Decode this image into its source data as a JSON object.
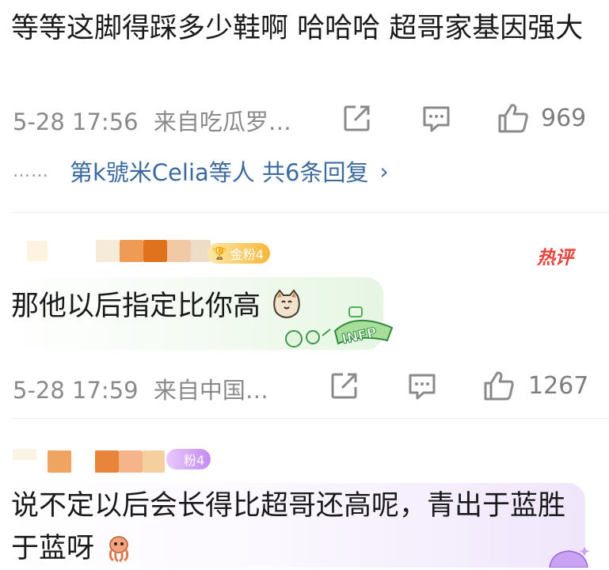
{
  "comment1": {
    "text": "等等这脚得踩多少鞋啊 哈哈哈 超哥家基因强大",
    "timestamp": "5-28 17:56",
    "source": "来自吃瓜罗…",
    "like_count": "969",
    "reply_dots": "……",
    "reply_summary": "第k號米Celia等人 共6条回复",
    "reply_chevron": "›"
  },
  "comment2": {
    "fan_badge": "金粉4",
    "hot_badge": "热评",
    "text": "那他以后指定比你高",
    "timestamp": "5-28 17:59",
    "source": "来自中国…",
    "like_count": "1267"
  },
  "comment3": {
    "fan_badge": "粉4",
    "text": "说不定以后会长得比超哥还高呢，青出于蓝胜于蓝呀"
  },
  "icons": {
    "share": "share-icon",
    "comment": "comment-icon",
    "like": "thumbs-up-icon",
    "cat_emoji": "cat-face-emoji",
    "infp_sticker": "infp-sticker",
    "octopus_emoji": "octopus-emoji"
  },
  "colors": {
    "link_blue": "#3c6a9e",
    "meta_gray": "#8a8a8a",
    "hot_red": "#e8423b",
    "gold_badge": "#f5b73a",
    "purple_badge": "#c58bf2"
  }
}
